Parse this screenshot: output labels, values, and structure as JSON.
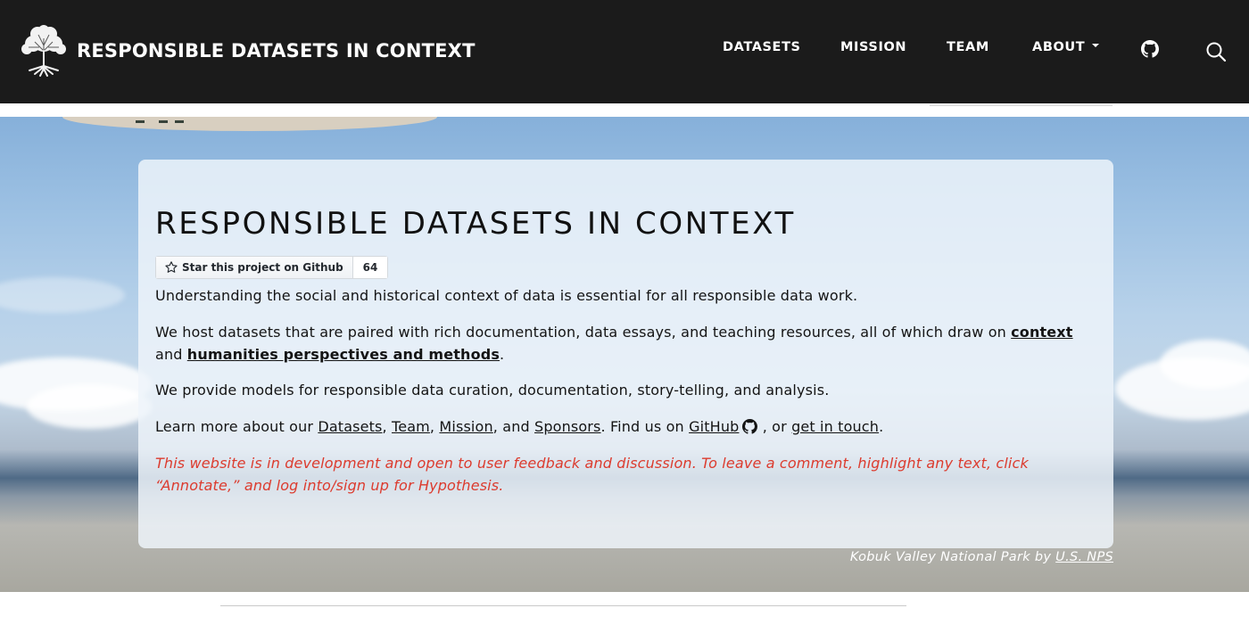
{
  "navbar": {
    "brand_title": "RESPONSIBLE DATASETS IN CONTEXT",
    "logo_icon": "tree-logo-icon",
    "links": [
      {
        "label": "DATASETS"
      },
      {
        "label": "MISSION"
      },
      {
        "label": "TEAM"
      },
      {
        "label": "ABOUT"
      }
    ],
    "github_icon": "github-icon",
    "search_icon": "search-icon",
    "background_color": "#1b1b1b"
  },
  "hero": {
    "title": "RESPONSIBLE DATASETS IN CONTEXT",
    "github_button": {
      "label": "Star this project on Github",
      "count": "64",
      "icon": "star-icon"
    },
    "intro": "Understanding the social and historical context of data is essential for all responsible data work.",
    "host": {
      "before": "We host datasets that are paired with rich documentation, data essays, and teaching resources, all of which draw on ",
      "link_context": "context",
      "middle": " and ",
      "link_humanities": "humanities perspectives and methods",
      "after": "."
    },
    "models": "We provide models for responsible data curation, documentation, story-telling, and analysis.",
    "learn": {
      "before": "Learn more about our ",
      "link_datasets": "Datasets",
      "sep1": ", ",
      "link_team": "Team",
      "sep2": ", ",
      "link_mission": "Mission",
      "sep3": ", and ",
      "link_sponsors": "Sponsors",
      "find": ". Find us on ",
      "link_github": "GitHub",
      "or": " , or ",
      "link_touch": "get in touch",
      "end": "."
    },
    "notice": "This website is in development and open to user feedback and discussion. To leave a comment, highlight any text, click “Annotate,” and log into/sign up for Hypothesis.",
    "notice_color": "#dc3b2e",
    "caption_text": "Kobuk Valley National Park by ",
    "caption_link": "U.S. NPS"
  }
}
